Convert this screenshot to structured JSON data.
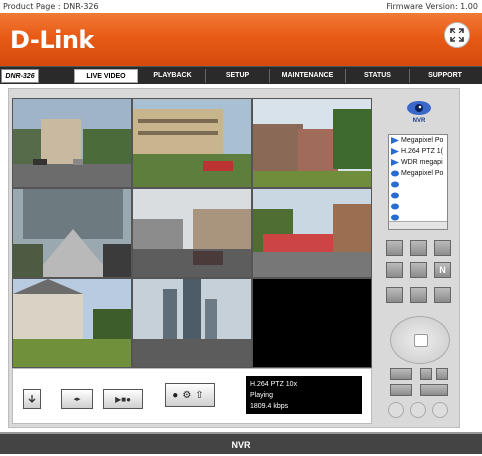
{
  "header": {
    "product_page": "Product Page : DNR-326",
    "firmware": "Firmware Version: 1.00",
    "logo": "D-Link"
  },
  "nav": {
    "model": "DNR-326",
    "tabs": [
      "LIVE VIDEO",
      "PLAYBACK",
      "SETUP",
      "MAINTENANCE",
      "STATUS",
      "SUPPORT"
    ],
    "active_tab": "LIVE VIDEO"
  },
  "camera_list": {
    "items": [
      "Megapixel Po",
      "H.264 PTZ 1(",
      "WDR megapi",
      "Megapixel Po",
      "",
      "",
      "",
      ""
    ]
  },
  "status": {
    "line1": "H.264 PTZ 10x",
    "line2": "Playing",
    "line3": "1809.4 kbps"
  },
  "footer": {
    "label": "NVR"
  },
  "panel": {
    "nvr_label": "NVR"
  }
}
